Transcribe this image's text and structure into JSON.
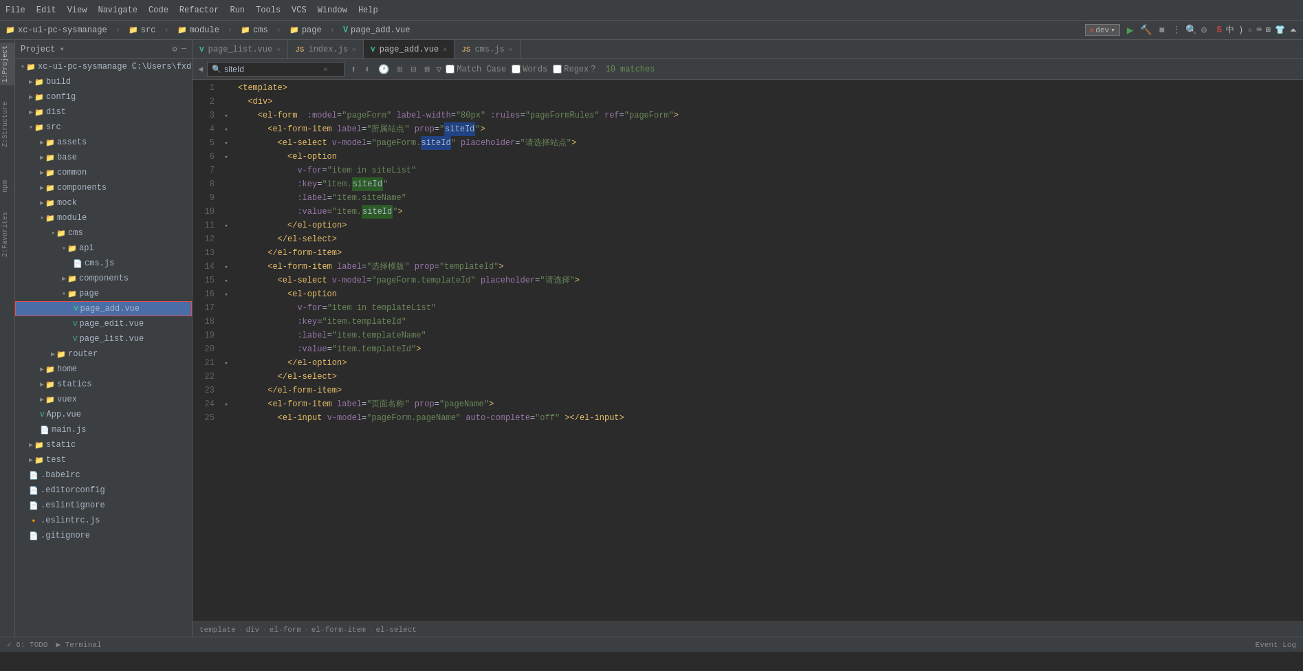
{
  "titleBar": {
    "menuItems": [
      "File",
      "Edit",
      "View",
      "Navigate",
      "Code",
      "Refactor",
      "Run",
      "Tools",
      "VCS",
      "Window",
      "Help"
    ]
  },
  "projectBar": {
    "project": "xc-ui-pc-sysmanage",
    "folders": [
      "src",
      "module",
      "cms",
      "page"
    ],
    "activeFile": "page_add.vue"
  },
  "tabs": [
    {
      "id": "tab-page-list",
      "label": "page_list.vue",
      "type": "vue",
      "closeable": true,
      "active": false
    },
    {
      "id": "tab-index-js",
      "label": "index.js",
      "type": "js",
      "closeable": true,
      "active": false
    },
    {
      "id": "tab-page-add",
      "label": "page_add.vue",
      "type": "vue",
      "closeable": true,
      "active": true
    },
    {
      "id": "tab-cms-js",
      "label": "cms.js",
      "type": "js",
      "closeable": true,
      "active": false
    }
  ],
  "search": {
    "value": "siteId",
    "placeholder": "siteId",
    "matchCount": "10 matches",
    "matchCase": "Match Case",
    "words": "Words",
    "regex": "Regex"
  },
  "fileTree": {
    "projectName": "xc-ui-pc-sysmanage",
    "projectPath": "C:\\Users\\fxd\\",
    "projectLabel": "Project",
    "items": [
      {
        "id": "build",
        "label": "build",
        "type": "folder",
        "level": 1,
        "expanded": false
      },
      {
        "id": "config",
        "label": "config",
        "type": "folder",
        "level": 1,
        "expanded": false
      },
      {
        "id": "dist",
        "label": "dist",
        "type": "folder",
        "level": 1,
        "expanded": false
      },
      {
        "id": "src",
        "label": "src",
        "type": "folder",
        "level": 1,
        "expanded": true
      },
      {
        "id": "assets",
        "label": "assets",
        "type": "folder",
        "level": 2,
        "expanded": false
      },
      {
        "id": "base",
        "label": "base",
        "type": "folder",
        "level": 2,
        "expanded": false
      },
      {
        "id": "common",
        "label": "common",
        "type": "folder",
        "level": 2,
        "expanded": false
      },
      {
        "id": "components",
        "label": "components",
        "type": "folder",
        "level": 2,
        "expanded": false
      },
      {
        "id": "mock",
        "label": "mock",
        "type": "folder",
        "level": 2,
        "expanded": false
      },
      {
        "id": "module",
        "label": "module",
        "type": "folder",
        "level": 2,
        "expanded": true
      },
      {
        "id": "cms",
        "label": "cms",
        "type": "folder",
        "level": 3,
        "expanded": true
      },
      {
        "id": "api",
        "label": "api",
        "type": "folder",
        "level": 4,
        "expanded": true
      },
      {
        "id": "cms-js",
        "label": "cms.js",
        "type": "js",
        "level": 5,
        "expanded": false
      },
      {
        "id": "components-folder",
        "label": "components",
        "type": "folder",
        "level": 4,
        "expanded": false
      },
      {
        "id": "page",
        "label": "page",
        "type": "folder",
        "level": 4,
        "expanded": true
      },
      {
        "id": "page-add-vue",
        "label": "page_add.vue",
        "type": "vue",
        "level": 5,
        "expanded": false,
        "active": true,
        "highlighted": true
      },
      {
        "id": "page-edit-vue",
        "label": "page_edit.vue",
        "type": "vue",
        "level": 5,
        "expanded": false
      },
      {
        "id": "page-list-vue",
        "label": "page_list.vue",
        "type": "vue",
        "level": 5,
        "expanded": false
      },
      {
        "id": "router",
        "label": "router",
        "type": "folder",
        "level": 3,
        "expanded": false
      },
      {
        "id": "home",
        "label": "home",
        "type": "folder",
        "level": 2,
        "expanded": false
      },
      {
        "id": "statics",
        "label": "statics",
        "type": "folder",
        "level": 2,
        "expanded": false
      },
      {
        "id": "vuex",
        "label": "vuex",
        "type": "folder",
        "level": 2,
        "expanded": false
      },
      {
        "id": "app-vue",
        "label": "App.vue",
        "type": "vue",
        "level": 2
      },
      {
        "id": "main-js",
        "label": "main.js",
        "type": "js-config",
        "level": 2
      },
      {
        "id": "static",
        "label": "static",
        "type": "folder",
        "level": 1,
        "expanded": false
      },
      {
        "id": "test",
        "label": "test",
        "type": "folder",
        "level": 1,
        "expanded": false
      },
      {
        "id": "babelrc",
        "label": ".babelrc",
        "type": "dot",
        "level": 1
      },
      {
        "id": "editorconfig",
        "label": ".editorconfig",
        "type": "dot",
        "level": 1
      },
      {
        "id": "eslintignore",
        "label": ".eslintignore",
        "type": "dot",
        "level": 1
      },
      {
        "id": "eslintrc-js",
        "label": ".eslintrc.js",
        "type": "dot-js",
        "level": 1
      },
      {
        "id": "gitignore",
        "label": ".gitignore",
        "type": "dot",
        "level": 1
      }
    ]
  },
  "codeLines": [
    {
      "num": 1,
      "content": "<template>",
      "indent": 0
    },
    {
      "num": 2,
      "content": "  <div>",
      "indent": 2
    },
    {
      "num": 3,
      "content": "    <el-form  :model=\"pageForm\" label-width=\"80px\" :rules=\"pageFormRules\" ref=\"pageForm\">",
      "indent": 4
    },
    {
      "num": 4,
      "content": "      <el-form-item label=\"所属站点\" prop=\"siteId\">",
      "indent": 6
    },
    {
      "num": 5,
      "content": "        <el-select v-model=\"pageForm.siteId\" placeholder=\"请选择站点\">",
      "indent": 8
    },
    {
      "num": 6,
      "content": "          <el-option",
      "indent": 10
    },
    {
      "num": 7,
      "content": "            v-for=\"item in siteList\"",
      "indent": 12
    },
    {
      "num": 8,
      "content": "            :key=\"item.siteId\"",
      "indent": 12
    },
    {
      "num": 9,
      "content": "            :label=\"item.siteName\"",
      "indent": 12
    },
    {
      "num": 10,
      "content": "            :value=\"item.siteId\">",
      "indent": 12
    },
    {
      "num": 11,
      "content": "          </el-option>",
      "indent": 10
    },
    {
      "num": 12,
      "content": "        </el-select>",
      "indent": 8
    },
    {
      "num": 13,
      "content": "      </el-form-item>",
      "indent": 6
    },
    {
      "num": 14,
      "content": "      <el-form-item label=\"选择模版\" prop=\"templateId\">",
      "indent": 6
    },
    {
      "num": 15,
      "content": "        <el-select v-model=\"pageForm.templateId\" placeholder=\"请选择\">",
      "indent": 8
    },
    {
      "num": 16,
      "content": "          <el-option",
      "indent": 10
    },
    {
      "num": 17,
      "content": "            v-for=\"item in templateList\"",
      "indent": 12
    },
    {
      "num": 18,
      "content": "            :key=\"item.templateId\"",
      "indent": 12
    },
    {
      "num": 19,
      "content": "            :label=\"item.templateName\"",
      "indent": 12
    },
    {
      "num": 20,
      "content": "            :value=\"item.templateId\">",
      "indent": 12
    },
    {
      "num": 21,
      "content": "          </el-option>",
      "indent": 10
    },
    {
      "num": 22,
      "content": "        </el-select>",
      "indent": 8
    },
    {
      "num": 23,
      "content": "      </el-form-item>",
      "indent": 6
    },
    {
      "num": 24,
      "content": "      <el-form-item label=\"页面名称\" prop=\"pageName\">",
      "indent": 6
    },
    {
      "num": 25,
      "content": "        <el-input v-model=\"pageForm.pageName\" auto-complete=\"off\" ></el-input>",
      "indent": 8
    }
  ],
  "breadcrumb": {
    "items": [
      "template",
      "div",
      "el-form",
      "el-form-item",
      "el-select"
    ]
  },
  "statusBar": {
    "todo": "6: TODO",
    "terminal": "Terminal",
    "eventLog": "Event Log"
  },
  "devBadge": "dev",
  "runControls": {
    "runIcon": "▶",
    "buildIcon": "🔨",
    "stopIcon": "■",
    "moreIcon": "⋮"
  }
}
